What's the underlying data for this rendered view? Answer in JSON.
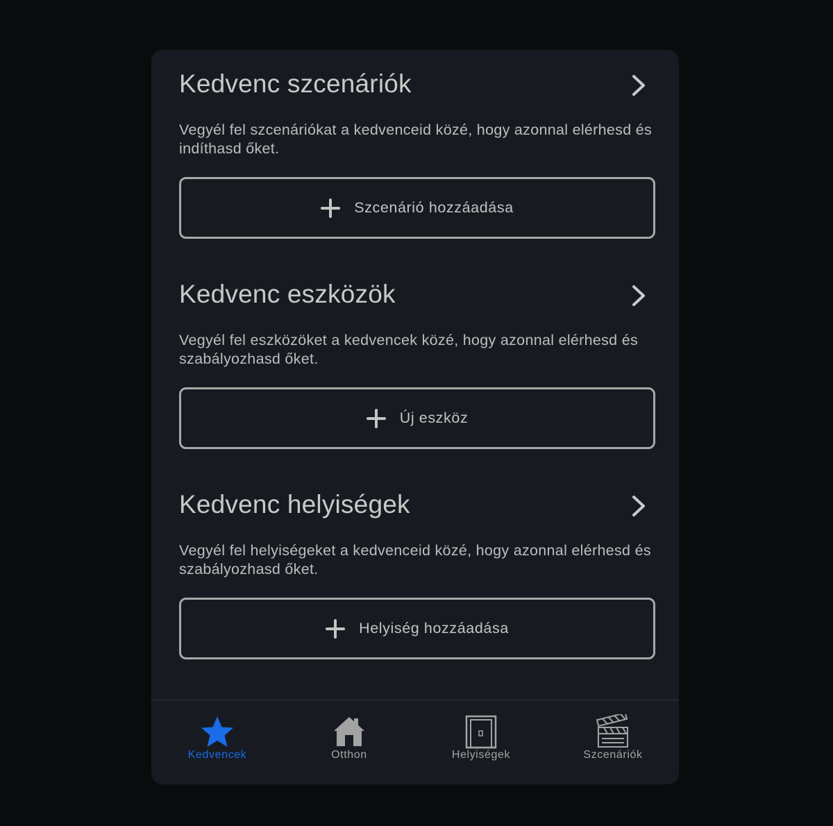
{
  "colors": {
    "background": "#0a0b0d",
    "card": "#171b21",
    "accent": "#1a6ce8",
    "text_primary": "#c9c9c9",
    "text_secondary": "#bdbdbd",
    "border": "#a8a8a8",
    "inactive_icon": "#a3a3a3"
  },
  "sections": [
    {
      "title": "Kedvenc szcenáriók",
      "description": "Vegyél fel szcenáriókat a kedvenceid közé, hogy azonnal elérhesd és indíthasd őket.",
      "button_label": "Szcenárió hozzáadása",
      "button_icon": "plus-icon",
      "header_icon": "chevron-right-icon"
    },
    {
      "title": "Kedvenc eszközök",
      "description": "Vegyél fel eszközöket a kedvencek közé, hogy azonnal elérhesd és szabályozhasd őket.",
      "button_label": "Új eszköz",
      "button_icon": "plus-icon",
      "header_icon": "chevron-right-icon"
    },
    {
      "title": "Kedvenc helyiségek",
      "description": "Vegyél fel helyiségeket a kedvenceid közé, hogy azonnal elérhesd és szabályozhasd őket.",
      "button_label": "Helyiség hozzáadása",
      "button_icon": "plus-icon",
      "header_icon": "chevron-right-icon"
    }
  ],
  "tabbar": {
    "tabs": [
      {
        "label": "Kedvencek",
        "icon": "star-icon",
        "active": true
      },
      {
        "label": "Otthon",
        "icon": "house-icon",
        "active": false
      },
      {
        "label": "Helyiségek",
        "icon": "door-icon",
        "active": false
      },
      {
        "label": "Szcenáriók",
        "icon": "clapperboard-icon",
        "active": false
      }
    ]
  }
}
